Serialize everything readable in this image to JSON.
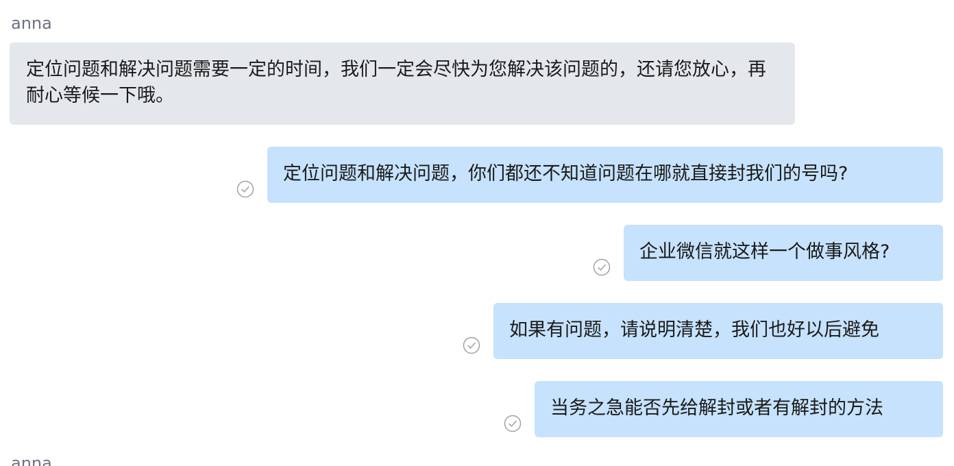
{
  "conversation": {
    "messages": [
      {
        "type": "incoming",
        "sender": "anna",
        "text": "定位问题和解决问题需要一定的时间，我们一定会尽快为您解决该问题的，还请您放心，再耐心等候一下哦。"
      },
      {
        "type": "outgoing",
        "text": "定位问题和解决问题，你们都还不知道问题在哪就直接封我们的号吗?",
        "status_icon": "read-check-icon"
      },
      {
        "type": "outgoing",
        "text": "企业微信就这样一个做事风格?",
        "status_icon": "read-check-icon"
      },
      {
        "type": "outgoing",
        "text": "如果有问题，请说明清楚，我们也好以后避免",
        "status_icon": "read-check-icon"
      },
      {
        "type": "outgoing",
        "text": "当务之急能否先给解封或者有解封的方法",
        "status_icon": "read-check-icon"
      },
      {
        "type": "incoming",
        "sender": "anna"
      }
    ]
  },
  "colors": {
    "incoming_bubble": "#e4e7eb",
    "outgoing_bubble": "#c6e2fc",
    "sender_name": "#6b7280",
    "read_icon": "#a0a0a0"
  }
}
